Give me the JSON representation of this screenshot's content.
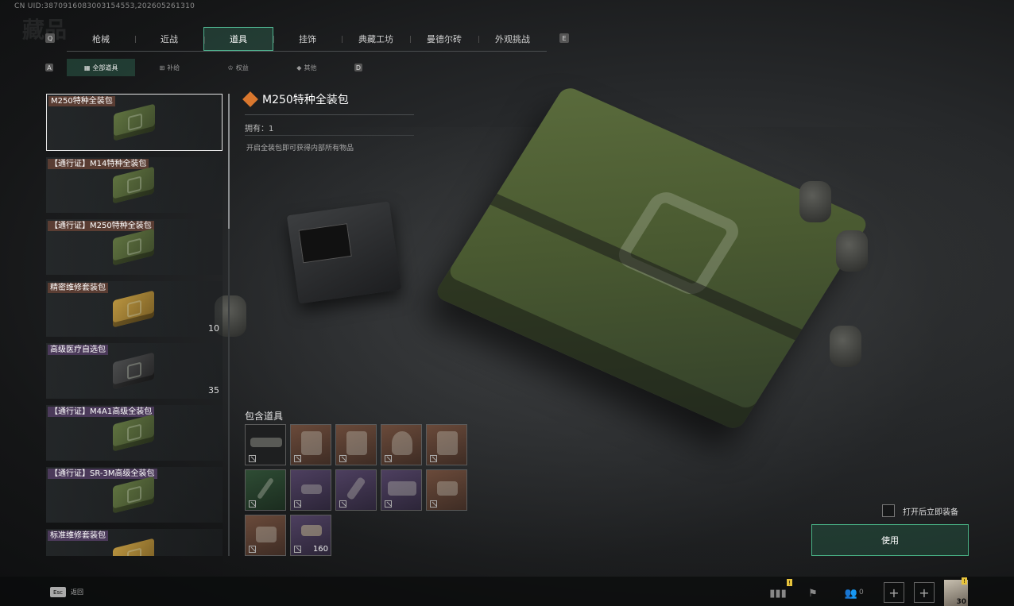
{
  "uid": "CN UID:3870916083003154553,202605261310",
  "top_tabs": {
    "left_key": "Q",
    "right_key": "E",
    "items": [
      {
        "label": "枪械",
        "active": false
      },
      {
        "label": "近战",
        "active": false
      },
      {
        "label": "道具",
        "active": true
      },
      {
        "label": "挂饰",
        "active": false
      },
      {
        "label": "典藏工坊",
        "active": false
      },
      {
        "label": "曼德尔砖",
        "active": false
      },
      {
        "label": "外观挑战",
        "active": false
      }
    ]
  },
  "sub_tabs": {
    "left_key": "A",
    "right_key": "D",
    "items": [
      {
        "label": "全部道具",
        "icon": "grid-icon",
        "active": true
      },
      {
        "label": "补给",
        "icon": "supply-icon",
        "active": false
      },
      {
        "label": "权益",
        "icon": "crown-icon",
        "active": false
      },
      {
        "label": "其他",
        "icon": "diamond-icon",
        "active": false
      }
    ]
  },
  "item_list": [
    {
      "name": "M250特种全装包",
      "tag_color": "brown",
      "crate": "green",
      "count": "",
      "selected": true
    },
    {
      "name": "【通行证】M14特种全装包",
      "tag_color": "brown",
      "crate": "green",
      "count": "",
      "selected": false
    },
    {
      "name": "【通行证】M250特种全装包",
      "tag_color": "brown",
      "crate": "green",
      "count": "",
      "selected": false
    },
    {
      "name": "精密维修套装包",
      "tag_color": "brown",
      "crate": "tan",
      "count": "10",
      "selected": false
    },
    {
      "name": "高级医疗自选包",
      "tag_color": "purple",
      "crate": "dark",
      "count": "35",
      "selected": false
    },
    {
      "name": "【通行证】M4A1高级全装包",
      "tag_color": "purple",
      "crate": "green",
      "count": "",
      "selected": false
    },
    {
      "name": "【通行证】SR-3M高级全装包",
      "tag_color": "purple",
      "crate": "green",
      "count": "",
      "selected": false
    },
    {
      "name": "标准维修套装包",
      "tag_color": "purple",
      "crate": "tan",
      "count": "",
      "selected": false
    }
  ],
  "detail": {
    "title": "M250特种全装包",
    "title_icon": "rarity-diamond-icon",
    "owned": "拥有：1",
    "description": "开启全装包即可获得内部所有物品",
    "included_label": "包含道具",
    "included_items": [
      {
        "icon": "rifle-icon",
        "rarity": "black",
        "count": ""
      },
      {
        "icon": "backpack-icon",
        "rarity": "brown",
        "count": ""
      },
      {
        "icon": "chest-rig-icon",
        "rarity": "brown",
        "count": ""
      },
      {
        "icon": "helmet-icon",
        "rarity": "brown",
        "count": ""
      },
      {
        "icon": "armor-vest-icon",
        "rarity": "brown",
        "count": ""
      },
      {
        "icon": "syringe-icon",
        "rarity": "green",
        "count": ""
      },
      {
        "icon": "ammo-box-icon",
        "rarity": "purple",
        "count": ""
      },
      {
        "icon": "injector-icon",
        "rarity": "purple",
        "count": ""
      },
      {
        "icon": "repair-kit-icon",
        "rarity": "purple",
        "count": ""
      },
      {
        "icon": "medkit-bag-icon",
        "rarity": "brown",
        "count": ""
      },
      {
        "icon": "first-aid-bag-icon",
        "rarity": "brown",
        "count": ""
      },
      {
        "icon": "ammo-box-icon",
        "rarity": "purple",
        "count": "160"
      }
    ]
  },
  "controls": {
    "auto_equip_label": "打开后立即装备",
    "auto_equip_checked": false,
    "use_button": "使用"
  },
  "bottom_bar": {
    "esc_key": "Esc",
    "esc_label": "返回",
    "friends_count": "0",
    "avatar_level": "30"
  },
  "colors": {
    "accent": "#4fb38f",
    "rarity_brown": "#5a3d33",
    "rarity_purple": "#4b3a5a",
    "rarity_green": "#2e4c34",
    "badge_yellow": "#e7c33c"
  }
}
